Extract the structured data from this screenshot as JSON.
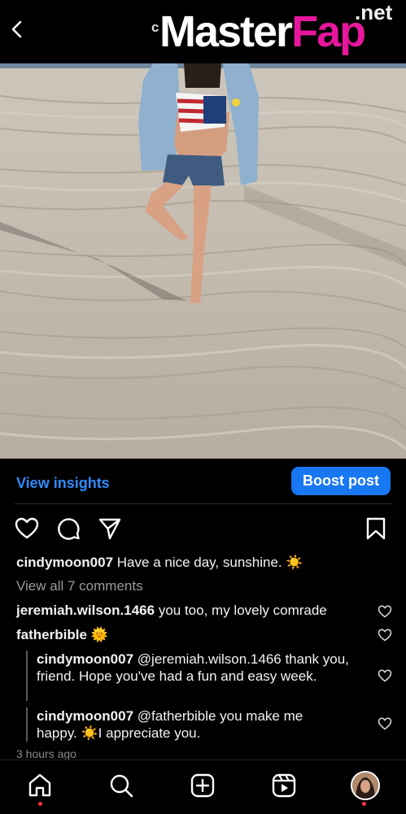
{
  "header": {
    "username_partial": "c",
    "watermark_main": "Master",
    "watermark_accent": "Fap",
    "watermark_tld": ".net"
  },
  "insights": {
    "view_label": "View insights",
    "boost_label": "Boost post"
  },
  "post": {
    "caption_user": "cindymoon007",
    "caption_text": "Have a nice day, sunshine.",
    "caption_emoji": "☀️",
    "view_all_comments": "View all 7 comments",
    "time_ago": "3 hours ago"
  },
  "comments": [
    {
      "user": "jeremiah.wilson.1466",
      "text": "you too, my lovely comrade"
    },
    {
      "user": "fatherbible",
      "text": "🌞"
    },
    {
      "user": "cindymoon007",
      "text": "@jeremiah.wilson.1466 thank you, friend. Hope you've had a fun and easy week."
    },
    {
      "user": "cindymoon007",
      "text": "@fatherbible you make me happy. ☀️I appreciate you."
    }
  ],
  "icons": {
    "back": "chevron-left-icon",
    "like": "heart-icon",
    "comment": "comment-icon",
    "share": "send-icon",
    "save": "bookmark-icon",
    "nav": [
      "home-icon",
      "search-icon",
      "create-icon",
      "reels-icon",
      "profile-avatar"
    ]
  },
  "colors": {
    "background": "#000000",
    "link": "#2f8cff",
    "boost_button": "#1877f2",
    "notification_dot": "#ff3040",
    "watermark_accent": "#e6179c"
  }
}
